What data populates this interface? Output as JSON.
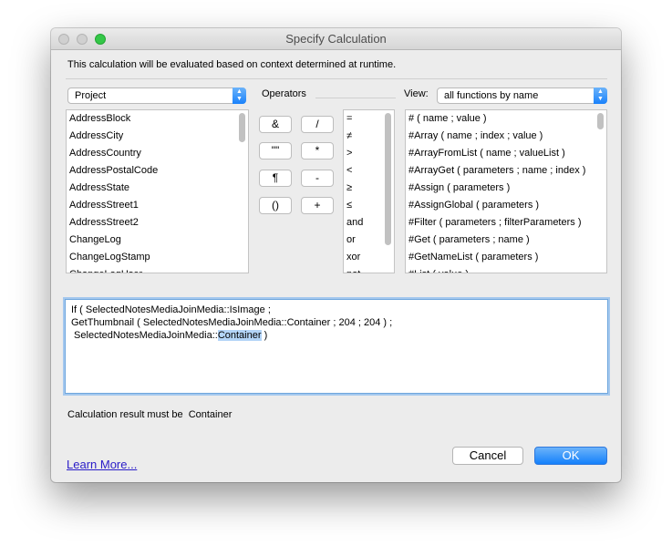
{
  "window": {
    "title": "Specify Calculation"
  },
  "info_text": "This calculation will be evaluated based on context determined at runtime.",
  "table_popup": {
    "selected": "Project"
  },
  "fields": [
    "AddressBlock",
    "AddressCity",
    "AddressCountry",
    "AddressPostalCode",
    "AddressState",
    "AddressStreet1",
    "AddressStreet2",
    "ChangeLog",
    "ChangeLogStamp",
    "ChangeLogUser"
  ],
  "operators": {
    "label": "Operators",
    "buttons": [
      "&",
      "/",
      "\"\"",
      "*",
      "¶",
      "-",
      "()",
      "+"
    ],
    "list": [
      "=",
      "≠",
      ">",
      "<",
      "≥",
      "≤",
      "and",
      "or",
      "xor",
      "not"
    ]
  },
  "view": {
    "label": "View:",
    "selected": "all functions by name"
  },
  "functions": [
    "# ( name ; value )",
    "#Array ( name ; index ; value )",
    "#ArrayFromList ( name ; valueList )",
    "#ArrayGet ( parameters ; name ; index )",
    "#Assign ( parameters )",
    "#AssignGlobal ( parameters )",
    "#Filter ( parameters ; filterParameters )",
    "#Get ( parameters ; name )",
    "#GetNameList ( parameters )",
    "#List ( value )"
  ],
  "calculation": {
    "line1": "If ( SelectedNotesMediaJoinMedia::IsImage ;",
    "line2": "GetThumbnail ( SelectedNotesMediaJoinMedia::Container ; 204 ; 204 ) ;",
    "line3_prefix": " SelectedNotesMediaJoinMedia::",
    "line3_selected": "Container",
    "line3_suffix": " )"
  },
  "result": {
    "label": "Calculation result must be",
    "value": "Container"
  },
  "learn_more": "Learn More...",
  "buttons": {
    "cancel": "Cancel",
    "ok": "OK"
  },
  "colors": {
    "accent": "#1a82fb",
    "zoom_button": "#34c748",
    "selection": "#b3d4f7",
    "link": "#2a1cc8"
  }
}
